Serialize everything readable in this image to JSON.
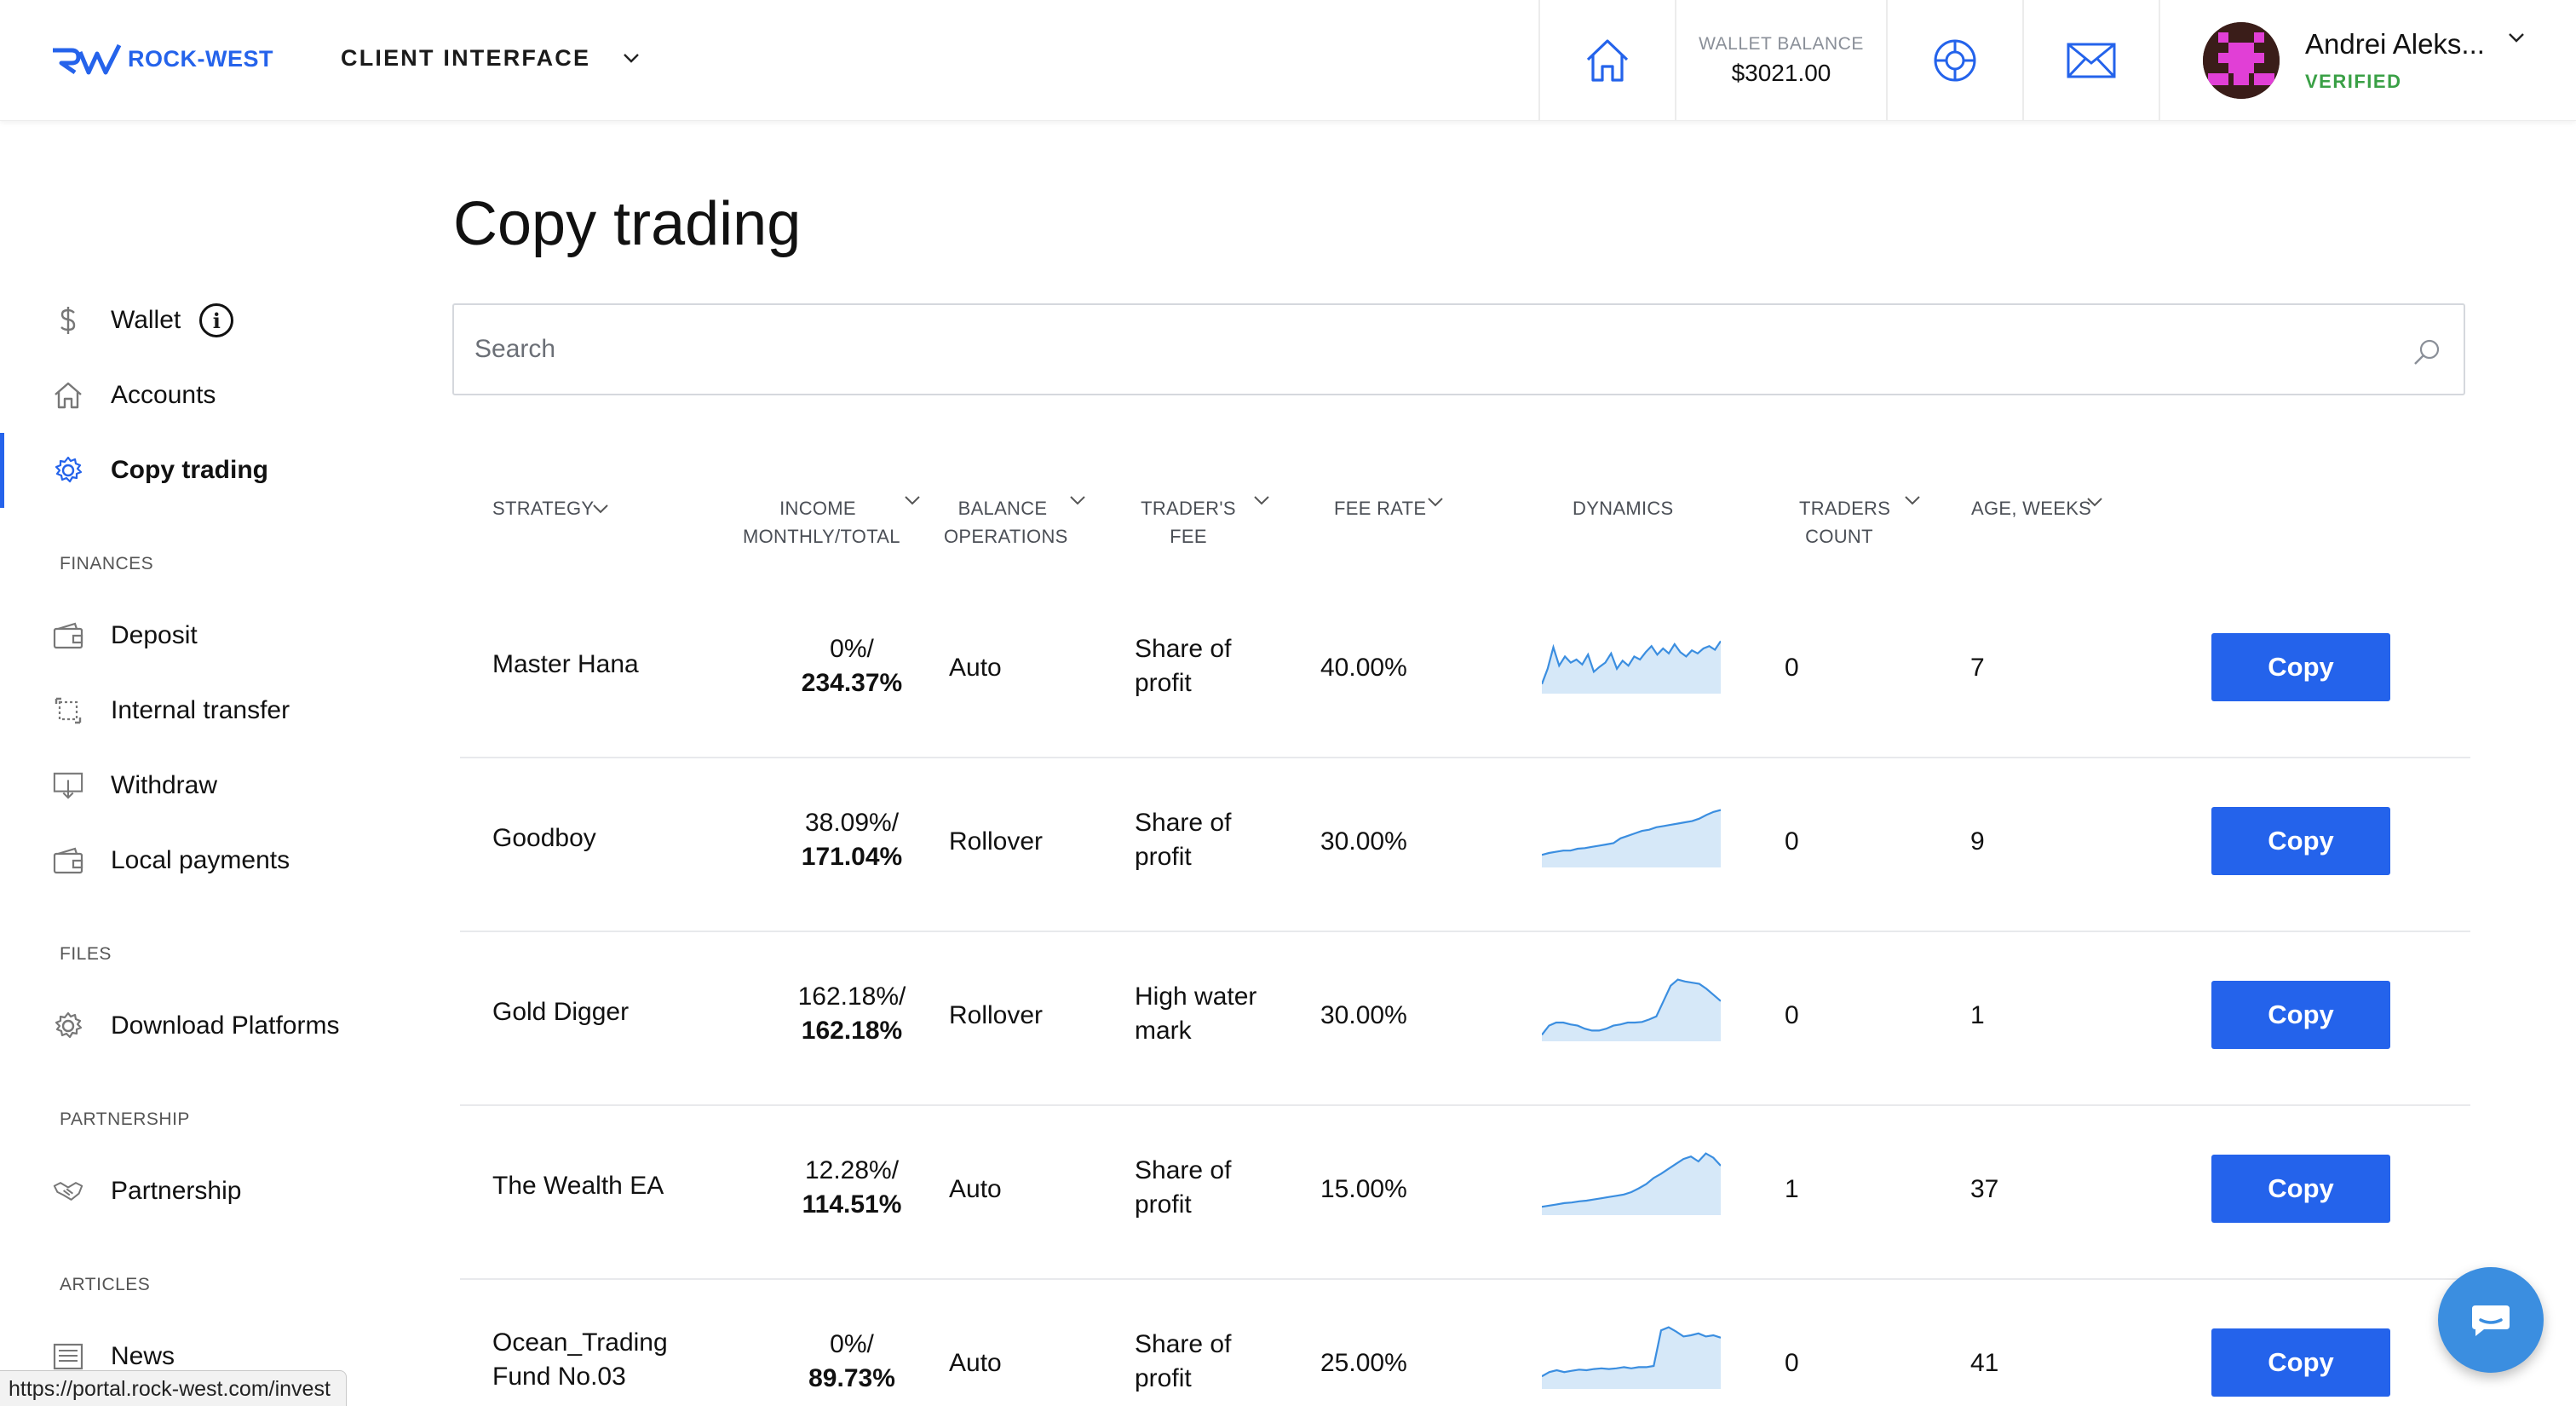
{
  "header": {
    "logo_text": "ROCK-WEST",
    "client_interface": "CLIENT INTERFACE",
    "wallet_balance_label": "WALLET BALANCE",
    "wallet_balance_value": "$3021.00",
    "user_name": "Andrei Aleks...",
    "user_status": "VERIFIED",
    "icons": [
      "home-icon",
      "support-icon",
      "mail-icon",
      "chevron-down-icon"
    ]
  },
  "sidebar": {
    "top_items": [
      {
        "label": "Wallet",
        "icon": "dollar-icon"
      },
      {
        "label": "Accounts",
        "icon": "house-icon"
      },
      {
        "label": "Copy trading",
        "icon": "gear-icon",
        "active": true
      }
    ],
    "sections": [
      {
        "title": "FINANCES",
        "items": [
          {
            "label": "Deposit",
            "icon": "wallet-in-icon"
          },
          {
            "label": "Internal transfer",
            "icon": "transfer-icon"
          },
          {
            "label": "Withdraw",
            "icon": "withdraw-icon"
          },
          {
            "label": "Local payments",
            "icon": "wallet-in-icon"
          }
        ]
      },
      {
        "title": "FILES",
        "items": [
          {
            "label": "Download Platforms",
            "icon": "gear-icon"
          }
        ]
      },
      {
        "title": "PARTNERSHIP",
        "items": [
          {
            "label": "Partnership",
            "icon": "handshake-icon"
          }
        ]
      },
      {
        "title": "ARTICLES",
        "items": [
          {
            "label": "News",
            "icon": "newspaper-icon"
          }
        ]
      }
    ]
  },
  "main": {
    "title": "Copy trading",
    "search_placeholder": "Search",
    "columns": {
      "strategy": "STRATEGY",
      "income_1": "INCOME",
      "income_2": "MONTHLY/TOTAL",
      "balance_1": "BALANCE",
      "balance_2": "OPERATIONS",
      "fee_1": "TRADER'S",
      "fee_2": "FEE",
      "rate": "FEE RATE",
      "dynamics": "DYNAMICS",
      "traders_1": "TRADERS",
      "traders_2": "COUNT",
      "age": "AGE, WEEKS"
    },
    "copy_label": "Copy",
    "rows": [
      {
        "strategy": "Master Hana",
        "strategy2": "",
        "income_monthly": "0%/",
        "income_total": "234.37%",
        "balance": "Auto",
        "fee1": "Share of",
        "fee2": "profit",
        "rate": "40.00%",
        "traders": "0",
        "age": "7",
        "dynamics": [
          0.1,
          0.35,
          0.7,
          0.4,
          0.55,
          0.45,
          0.5,
          0.42,
          0.58,
          0.3,
          0.38,
          0.45,
          0.6,
          0.35,
          0.48,
          0.4,
          0.55,
          0.5,
          0.62,
          0.72,
          0.58,
          0.68,
          0.6,
          0.75,
          0.62,
          0.55,
          0.65,
          0.6,
          0.68,
          0.72,
          0.66,
          0.8
        ]
      },
      {
        "strategy": "Goodboy",
        "strategy2": "",
        "income_monthly": "38.09%/",
        "income_total": "171.04%",
        "balance": "Rollover",
        "fee1": "Share of",
        "fee2": "profit",
        "rate": "30.00%",
        "traders": "0",
        "age": "9",
        "dynamics": [
          0.15,
          0.18,
          0.2,
          0.22,
          0.22,
          0.25,
          0.26,
          0.28,
          0.3,
          0.32,
          0.34,
          0.42,
          0.46,
          0.5,
          0.54,
          0.56,
          0.6,
          0.62,
          0.64,
          0.66,
          0.68,
          0.7,
          0.74,
          0.8,
          0.85,
          0.88
        ]
      },
      {
        "strategy": "Gold Digger",
        "strategy2": "",
        "income_monthly": "162.18%/",
        "income_total": "162.18%",
        "balance": "Rollover",
        "fee1": "High water",
        "fee2": "mark",
        "rate": "30.00%",
        "traders": "0",
        "age": "1",
        "dynamics": [
          0.05,
          0.2,
          0.25,
          0.25,
          0.22,
          0.2,
          0.15,
          0.12,
          0.12,
          0.15,
          0.2,
          0.22,
          0.25,
          0.25,
          0.26,
          0.3,
          0.35,
          0.6,
          0.85,
          0.95,
          0.92,
          0.9,
          0.88,
          0.8,
          0.7,
          0.6
        ]
      },
      {
        "strategy": "The Wealth EA",
        "strategy2": "",
        "income_monthly": "12.28%/",
        "income_total": "114.51%",
        "balance": "Auto",
        "fee1": "Share of",
        "fee2": "profit",
        "rate": "15.00%",
        "traders": "1",
        "age": "37",
        "dynamics": [
          0.08,
          0.1,
          0.12,
          0.14,
          0.15,
          0.17,
          0.18,
          0.2,
          0.22,
          0.24,
          0.26,
          0.28,
          0.32,
          0.38,
          0.45,
          0.55,
          0.62,
          0.7,
          0.78,
          0.86,
          0.9,
          0.82,
          0.95,
          0.88,
          0.75
        ]
      },
      {
        "strategy": "Ocean_Trading",
        "strategy2": "Fund No.03",
        "income_monthly": "0%/",
        "income_total": "89.73%",
        "balance": "Auto",
        "fee1": "Share of",
        "fee2": "profit",
        "rate": "25.00%",
        "traders": "0",
        "age": "41",
        "dynamics": [
          0.15,
          0.22,
          0.25,
          0.22,
          0.24,
          0.26,
          0.25,
          0.27,
          0.28,
          0.27,
          0.28,
          0.3,
          0.28,
          0.3,
          0.3,
          0.32,
          0.9,
          0.95,
          0.88,
          0.8,
          0.82,
          0.85,
          0.8,
          0.82,
          0.78
        ]
      }
    ]
  },
  "status_bar_url": "https://portal.rock-west.com/invest",
  "colors": {
    "accent": "#2463eb",
    "verified": "#3aa046",
    "spark_line": "#3b8ee0",
    "spark_fill": "#d6e8f8"
  }
}
